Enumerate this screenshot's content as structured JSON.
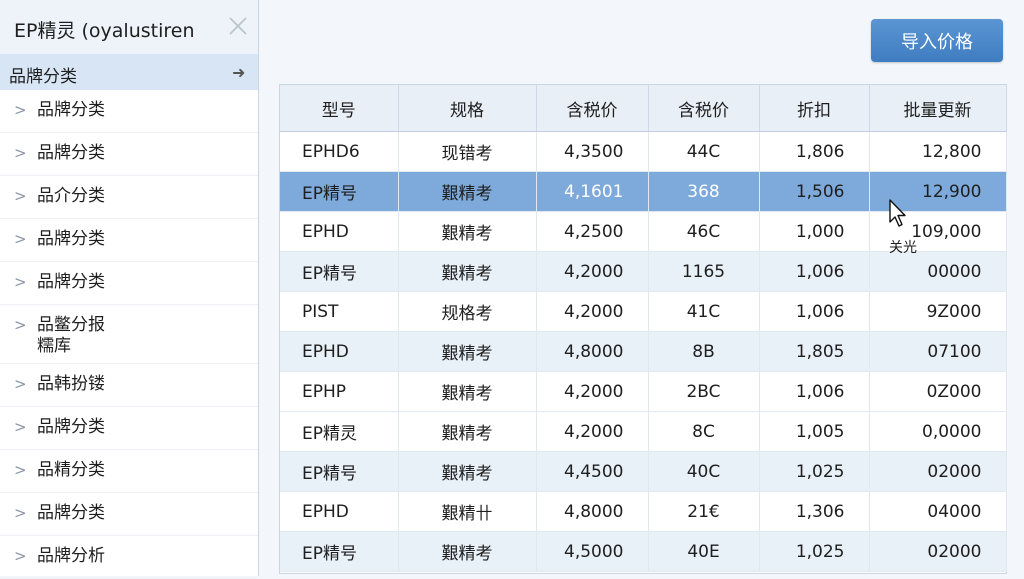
{
  "app": {
    "title": "EP精灵 (oyalustiren"
  },
  "sidebar": {
    "header": "品牌分类",
    "items": [
      {
        "label": "品牌分类"
      },
      {
        "label": "品牌分类"
      },
      {
        "label": "品介分类"
      },
      {
        "label": "品牌分类"
      },
      {
        "label": "品牌分类"
      },
      {
        "label": "品鳖分报\n糯库"
      },
      {
        "label": "品韩扮镂"
      },
      {
        "label": "品牌分类"
      },
      {
        "label": "品精分类"
      },
      {
        "label": "品牌分类"
      },
      {
        "label": "品牌分析"
      }
    ]
  },
  "toolbar": {
    "import_label": "导入价格"
  },
  "table": {
    "headers": [
      "型号",
      "规格",
      "含税价",
      "含税价",
      "折扣",
      "批量更新"
    ],
    "rows": [
      [
        "EPHD6",
        "现错考",
        "4,3500",
        "44C",
        "1,806",
        "12,800"
      ],
      [
        "EP精号",
        "艱精考",
        "4,1601",
        "368",
        "1,506",
        "12,900"
      ],
      [
        "EPHD",
        "艱精考",
        "4,2500",
        "46C",
        "1,000",
        "109,000"
      ],
      [
        "EP精号",
        "艱精考",
        "4,2000",
        "1165",
        "1,006",
        "00000"
      ],
      [
        "PIST",
        "规格考",
        "4,2000",
        "41C",
        "1,006",
        "9Z000"
      ],
      [
        "EPHD",
        "艱精考",
        "4,8000",
        "8B",
        "1,805",
        "07100"
      ],
      [
        "EPHP",
        "艱精考",
        "4,2000",
        "2BC",
        "1,006",
        "0Z000"
      ],
      [
        "EP精灵",
        "艱精考",
        "4,2000",
        "8C",
        "1,005",
        "0,0000"
      ],
      [
        "EP精号",
        "艱精考",
        "4,4500",
        "40C",
        "1,025",
        "02000"
      ],
      [
        "EPHD",
        "艱精卄",
        "4,8000",
        "21€",
        "1,306",
        "04000"
      ],
      [
        "EP精号",
        "艱精考",
        "4,5000",
        "40E",
        "1,025",
        "02000"
      ]
    ],
    "selected_row": 1
  },
  "tooltip": {
    "text": "关光"
  },
  "colors": {
    "accent": "#3f7dc1",
    "selection": "#7eaadb",
    "row_alt": "#e8f0f8"
  },
  "icons": {
    "close": "close-icon",
    "arrow": "arrow-right-icon",
    "chevron": "chevron-right-icon",
    "cursor": "mouse-pointer-icon"
  }
}
